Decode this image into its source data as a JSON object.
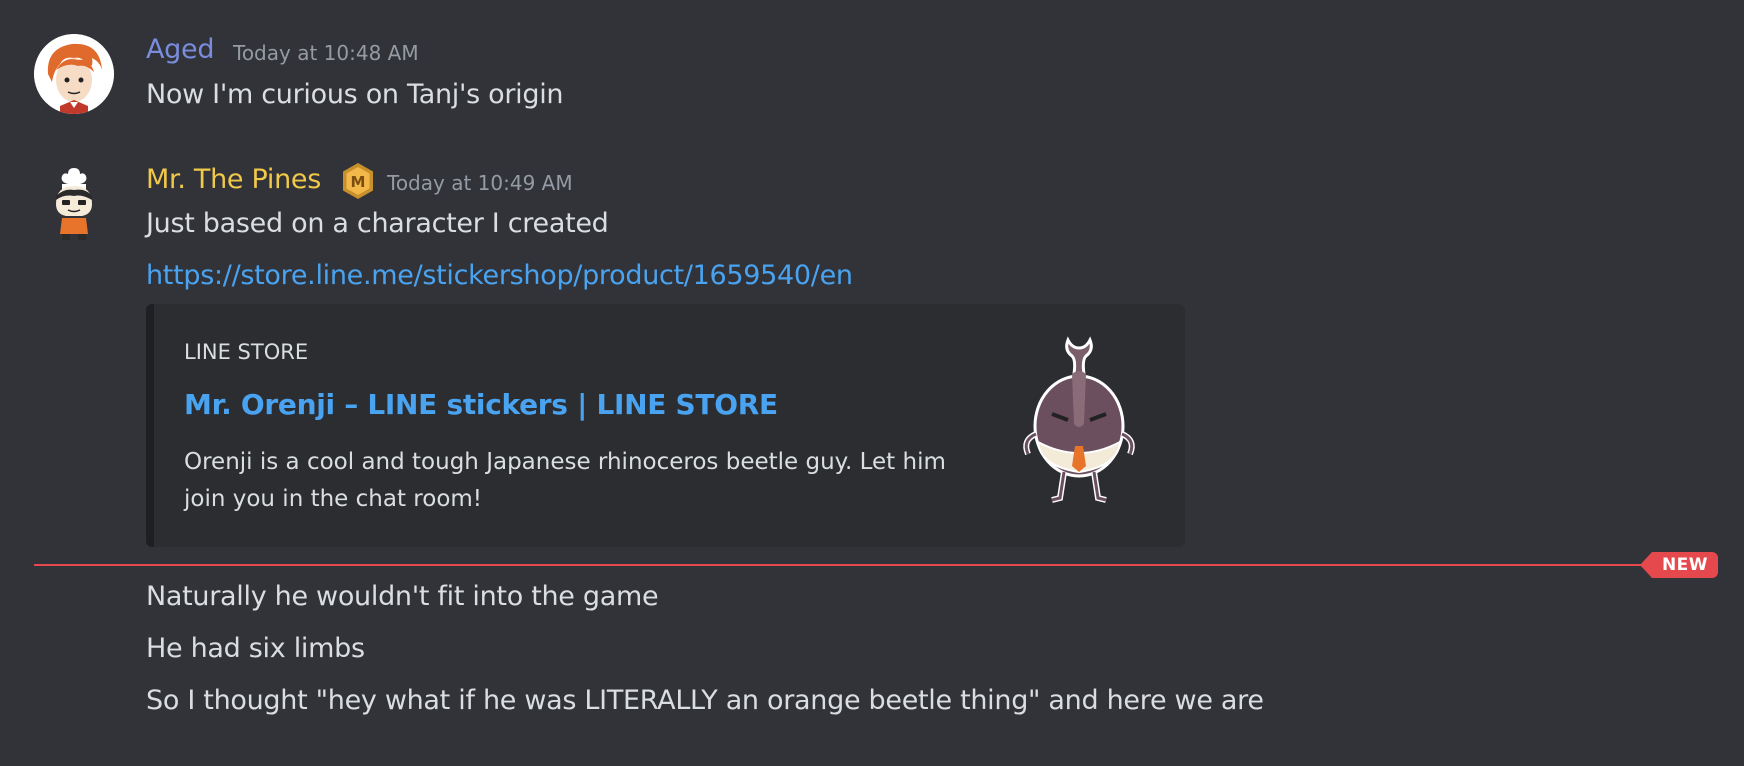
{
  "messages": [
    {
      "author": "Aged",
      "author_color": "#7b8cde",
      "timestamp": "Today at 10:48 AM",
      "lines": [
        "Now I'm curious on Tanj's origin"
      ],
      "avatar_icon": "orange-hair-portrait-avatar"
    },
    {
      "author": "Mr. The Pines",
      "author_color": "#f0c84a",
      "timestamp": "Today at 10:49 AM",
      "badge_icon": "hexagon-m-badge-icon",
      "badge_letter": "M",
      "lines": [
        "Just based on a character I created"
      ],
      "link": "https://store.line.me/stickershop/product/1659540/en",
      "avatar_icon": "chef-character-avatar",
      "embed": {
        "provider": "LINE STORE",
        "title": "Mr. Orenji – LINE stickers | LINE STORE",
        "description": "Orenji is a cool and tough Japanese rhinoceros beetle guy. Let him join you in the chat room!",
        "thumbnail_icon": "rhinoceros-beetle-sticker"
      }
    }
  ],
  "divider": {
    "label": "NEW",
    "color": "#e5484d"
  },
  "followups": [
    "Naturally he wouldn't fit into the game",
    "He had six limbs",
    "So I thought \"hey what if he was LITERALLY an orange beetle thing\" and here we are"
  ],
  "colors": {
    "background": "#313338",
    "embed_background": "#2b2d31",
    "link": "#4aa3f0",
    "timestamp": "#949ba4"
  }
}
